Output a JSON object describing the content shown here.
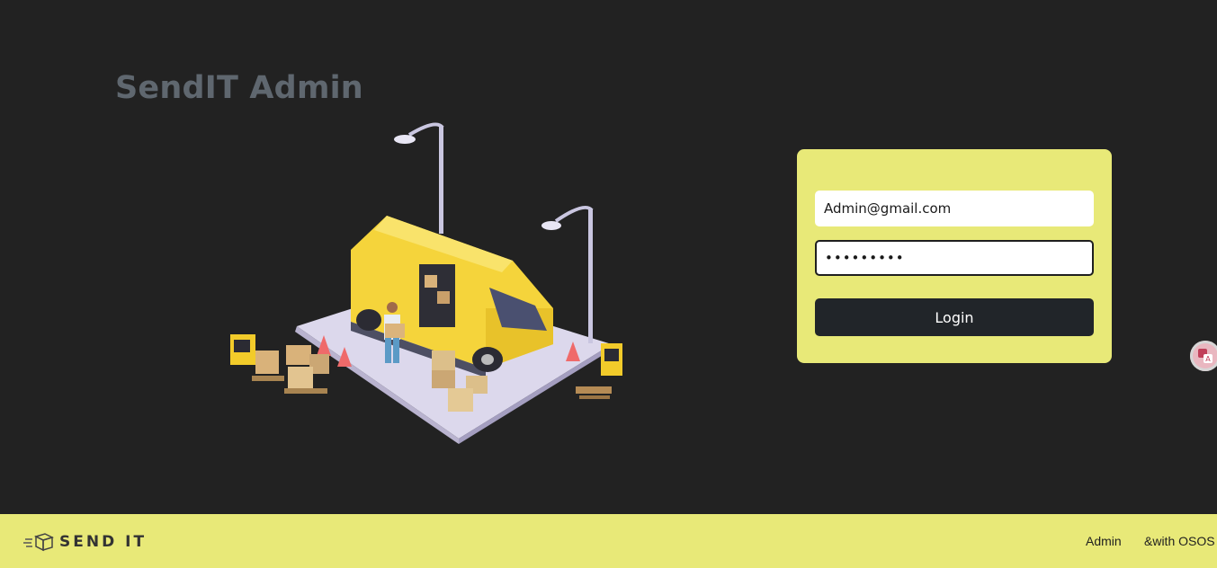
{
  "page": {
    "title": "SendIT Admin"
  },
  "login": {
    "email_value": "Admin@gmail.com",
    "password_value": "123456789",
    "button_label": "Login"
  },
  "footer": {
    "brand": "SEND IT",
    "links": [
      "Admin",
      "&with OSOS"
    ]
  },
  "illustration": {
    "icon": "delivery-van-illustration"
  },
  "widget": {
    "icon": "translate-icon"
  },
  "colors": {
    "background": "#222222",
    "accent": "#e8e978",
    "button": "#212529",
    "title": "#5f676f",
    "van": "#f5d43b"
  }
}
